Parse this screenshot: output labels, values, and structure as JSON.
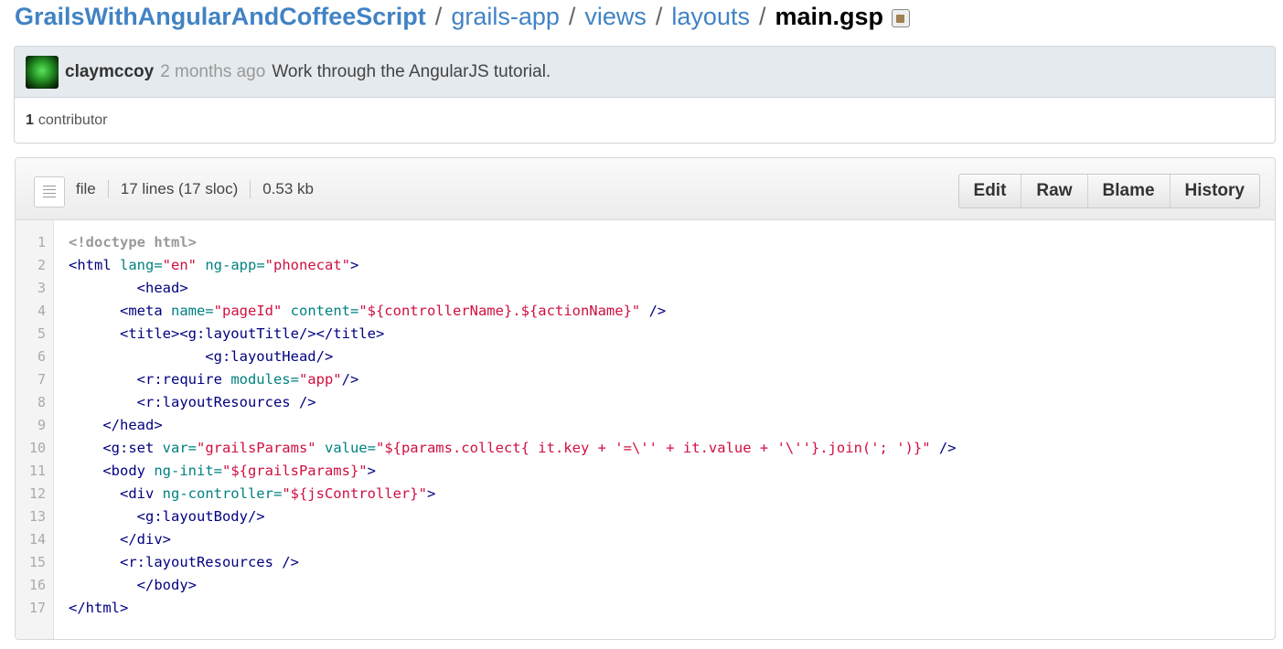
{
  "breadcrumb": {
    "repo": "GrailsWithAngularAndCoffeeScript",
    "separator": "/",
    "dirs": [
      "grails-app",
      "views",
      "layouts"
    ],
    "file": "main.gsp"
  },
  "commit": {
    "author": "claymccoy",
    "time_ago": "2 months ago",
    "message": "Work through the AngularJS tutorial.",
    "contributor_count": "1",
    "contributor_label": "contributor"
  },
  "file": {
    "mode": "file",
    "lines_info": "17 lines (17 sloc)",
    "size": "0.53 kb",
    "buttons": [
      "Edit",
      "Raw",
      "Blame",
      "History"
    ]
  },
  "code": {
    "line_numbers": [
      "1",
      "2",
      "3",
      "4",
      "5",
      "6",
      "7",
      "8",
      "9",
      "10",
      "11",
      "12",
      "13",
      "14",
      "15",
      "16",
      "17"
    ],
    "lines": [
      [
        {
          "t": "doc",
          "s": "<!doctype html>"
        }
      ],
      [
        {
          "t": "tag",
          "s": "<html "
        },
        {
          "t": "attr",
          "s": "lang="
        },
        {
          "t": "str",
          "s": "\"en\""
        },
        {
          "t": "tag",
          "s": " "
        },
        {
          "t": "attr",
          "s": "ng-app="
        },
        {
          "t": "str",
          "s": "\"phonecat\""
        },
        {
          "t": "tag",
          "s": ">"
        }
      ],
      [
        {
          "t": "tag",
          "s": "        <head>"
        }
      ],
      [
        {
          "t": "tag",
          "s": "      <meta "
        },
        {
          "t": "attr",
          "s": "name="
        },
        {
          "t": "str",
          "s": "\"pageId\""
        },
        {
          "t": "tag",
          "s": " "
        },
        {
          "t": "attr",
          "s": "content="
        },
        {
          "t": "str",
          "s": "\"${controllerName}.${actionName}\""
        },
        {
          "t": "tag",
          "s": " />"
        }
      ],
      [
        {
          "t": "tag",
          "s": "      <title><g:layoutTitle/></title>"
        }
      ],
      [
        {
          "t": "tag",
          "s": "                <g:layoutHead/>"
        }
      ],
      [
        {
          "t": "tag",
          "s": "        <r:require "
        },
        {
          "t": "attr",
          "s": "modules="
        },
        {
          "t": "str",
          "s": "\"app\""
        },
        {
          "t": "tag",
          "s": "/>"
        }
      ],
      [
        {
          "t": "tag",
          "s": "        <r:layoutResources />"
        }
      ],
      [
        {
          "t": "tag",
          "s": "    </head>"
        }
      ],
      [
        {
          "t": "tag",
          "s": "    <g:set "
        },
        {
          "t": "attr",
          "s": "var="
        },
        {
          "t": "str",
          "s": "\"grailsParams\""
        },
        {
          "t": "tag",
          "s": " "
        },
        {
          "t": "attr",
          "s": "value="
        },
        {
          "t": "str",
          "s": "\"${params.collect{ it.key + '=\\'' + it.value + '\\''}.join('; ')}\""
        },
        {
          "t": "tag",
          "s": " />"
        }
      ],
      [
        {
          "t": "tag",
          "s": "    <body "
        },
        {
          "t": "attr",
          "s": "ng-init="
        },
        {
          "t": "str",
          "s": "\"${grailsParams}\""
        },
        {
          "t": "tag",
          "s": ">"
        }
      ],
      [
        {
          "t": "tag",
          "s": "      <div "
        },
        {
          "t": "attr",
          "s": "ng-controller="
        },
        {
          "t": "str",
          "s": "\"${jsController}\""
        },
        {
          "t": "tag",
          "s": ">"
        }
      ],
      [
        {
          "t": "tag",
          "s": "        <g:layoutBody/>"
        }
      ],
      [
        {
          "t": "tag",
          "s": "      </div>"
        }
      ],
      [
        {
          "t": "tag",
          "s": "      <r:layoutResources />"
        }
      ],
      [
        {
          "t": "tag",
          "s": "        </body>"
        }
      ],
      [
        {
          "t": "tag",
          "s": "</html>"
        }
      ]
    ]
  },
  "colors": {
    "link": "#4183c4",
    "tag": "#000080",
    "attr": "#008080",
    "string": "#d01040",
    "doctype": "#999999"
  },
  "icons": [
    "clipboard-icon",
    "file-icon"
  ]
}
